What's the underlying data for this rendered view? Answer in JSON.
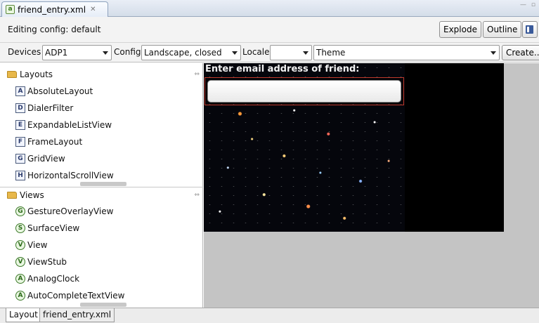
{
  "editor": {
    "tab_title": "friend_entry.xml",
    "close_glyph": "✕",
    "window_controls": "— ▫"
  },
  "config": {
    "editing_label": "Editing config: default",
    "explode_label": "Explode",
    "outline_label": "Outline"
  },
  "devices": {
    "devices_label": "Devices",
    "device_value": "ADP1",
    "config_label": "Config",
    "config_value": "Landscape, closed",
    "locale_label": "Locale",
    "locale_value": "",
    "theme_value": "Theme",
    "create_label": "Create..."
  },
  "palette": {
    "layouts_header": "Layouts",
    "layouts": [
      {
        "icon": "A",
        "label": "AbsoluteLayout"
      },
      {
        "icon": "D",
        "label": "DialerFilter"
      },
      {
        "icon": "E",
        "label": "ExpandableListView"
      },
      {
        "icon": "F",
        "label": "FrameLayout"
      },
      {
        "icon": "G",
        "label": "GridView"
      },
      {
        "icon": "H",
        "label": "HorizontalScrollView"
      }
    ],
    "views_header": "Views",
    "views": [
      {
        "icon": "G",
        "label": "GestureOverlayView"
      },
      {
        "icon": "S",
        "label": "SurfaceView"
      },
      {
        "icon": "V",
        "label": "View"
      },
      {
        "icon": "V",
        "label": "ViewStub"
      },
      {
        "icon": "A",
        "label": "AnalogClock"
      },
      {
        "icon": "A",
        "label": "AutoCompleteTextView"
      }
    ]
  },
  "canvas": {
    "friend_label": "Enter email address of friend:",
    "email_value": ""
  },
  "bottom_tabs": {
    "layout_tab": "Layout",
    "xml_tab": "friend_entry.xml"
  }
}
